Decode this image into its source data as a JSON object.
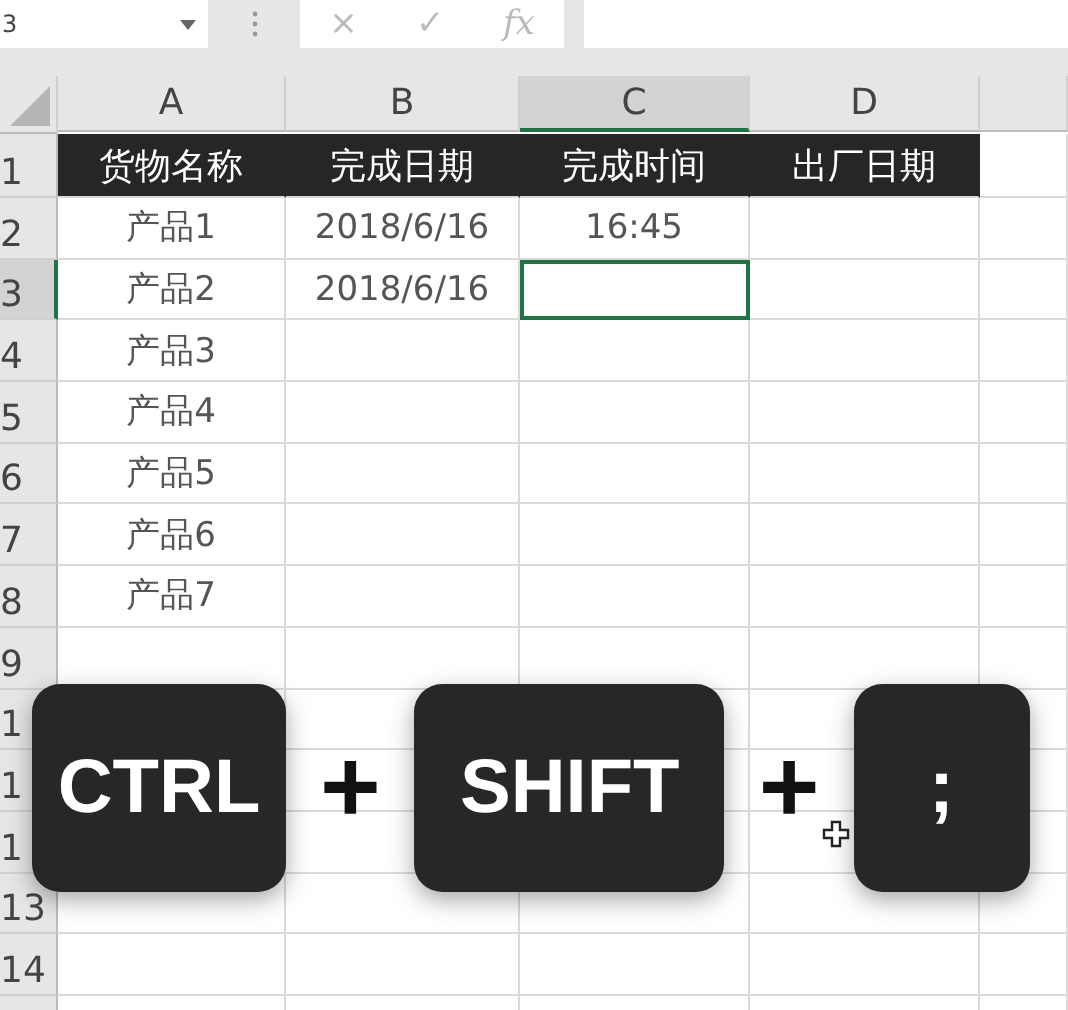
{
  "name_box": {
    "value": "3"
  },
  "formula_bar": {
    "cancel": "×",
    "enter": "✓",
    "function": "fx"
  },
  "columns": [
    {
      "label": "A",
      "selected": false
    },
    {
      "label": "B",
      "selected": false
    },
    {
      "label": "C",
      "selected": true
    },
    {
      "label": "D",
      "selected": false
    }
  ],
  "rows": [
    {
      "number": "1",
      "selected": false,
      "kind": "heading",
      "cells": {
        "A": "货物名称",
        "B": "完成日期",
        "C": "完成时间",
        "D": "出厂日期"
      }
    },
    {
      "number": "2",
      "selected": false,
      "kind": "data",
      "cells": {
        "A": "产品1",
        "B": "2018/6/16",
        "C": "16:45"
      }
    },
    {
      "number": "3",
      "selected": true,
      "kind": "data",
      "cells": {
        "A": "产品2",
        "B": "2018/6/16"
      }
    },
    {
      "number": "4",
      "selected": false,
      "kind": "data",
      "cells": {
        "A": "产品3"
      }
    },
    {
      "number": "5",
      "selected": false,
      "kind": "data",
      "cells": {
        "A": "产品4"
      }
    },
    {
      "number": "6",
      "selected": false,
      "kind": "data",
      "cells": {
        "A": "产品5"
      }
    },
    {
      "number": "7",
      "selected": false,
      "kind": "data",
      "cells": {
        "A": "产品6"
      }
    },
    {
      "number": "8",
      "selected": false,
      "kind": "data",
      "cells": {
        "A": "产品7"
      }
    },
    {
      "number": "9",
      "selected": false,
      "kind": "data",
      "cells": {}
    },
    {
      "number": "1",
      "selected": false,
      "kind": "data",
      "cells": {}
    },
    {
      "number": "1",
      "selected": false,
      "kind": "data",
      "cells": {}
    },
    {
      "number": "1",
      "selected": false,
      "kind": "data",
      "cells": {}
    },
    {
      "number": "13",
      "selected": false,
      "kind": "data",
      "cells": {}
    },
    {
      "number": "14",
      "selected": false,
      "kind": "data",
      "cells": {}
    }
  ],
  "shortcut": [
    {
      "kind": "key",
      "label": "CTRL"
    },
    {
      "kind": "plus",
      "label": "+"
    },
    {
      "kind": "key",
      "label": "SHIFT"
    },
    {
      "kind": "plus",
      "label": "+"
    },
    {
      "kind": "key",
      "label": ";"
    }
  ]
}
